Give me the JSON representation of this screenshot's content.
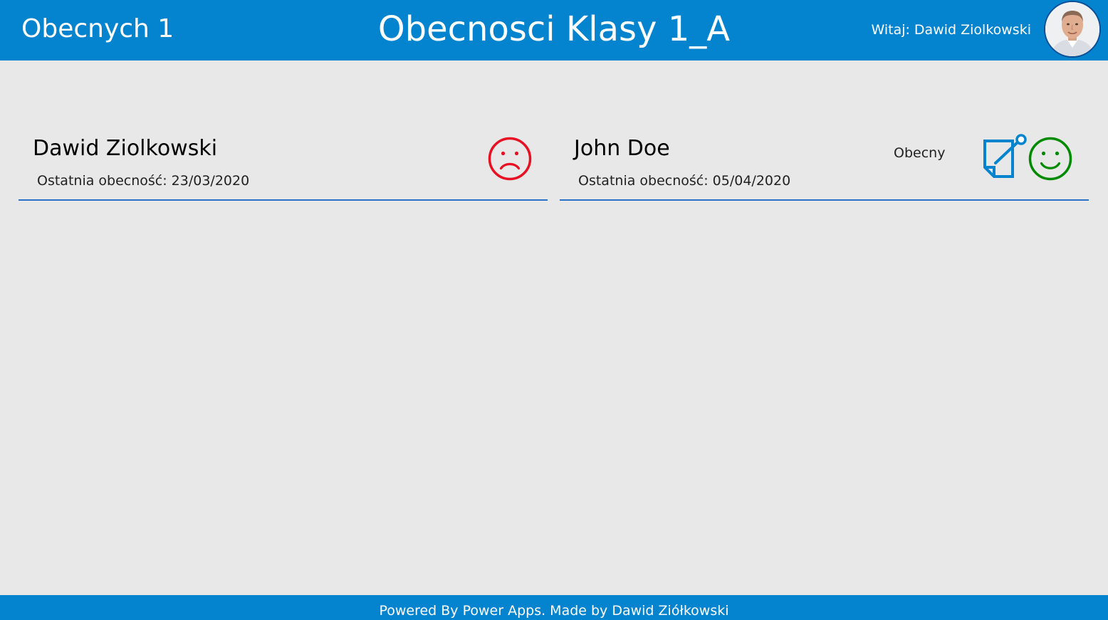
{
  "header": {
    "present_count_label": "Obecnych 1",
    "title": "Obecnosci Klasy 1_A",
    "welcome": "Witaj: Dawid Ziolkowski",
    "background_color": "#0483cf"
  },
  "students": [
    {
      "name": "Dawid Ziolkowski",
      "last_attendance": "Ostatnia obecność: 23/03/2020",
      "status": "",
      "status_icon": "sad-face-icon",
      "status_color": "#e81123",
      "has_note_icon": false
    },
    {
      "name": "John Doe",
      "last_attendance": "Ostatnia obecność: 05/04/2020",
      "status": "Obecny",
      "status_icon": "happy-face-icon",
      "status_color": "#008a00",
      "has_note_icon": true,
      "note_icon": "note-edit-icon",
      "note_icon_color": "#0483cf"
    }
  ],
  "footer": {
    "text": "Powered By Power Apps. Made by Dawid Ziółkowski"
  }
}
